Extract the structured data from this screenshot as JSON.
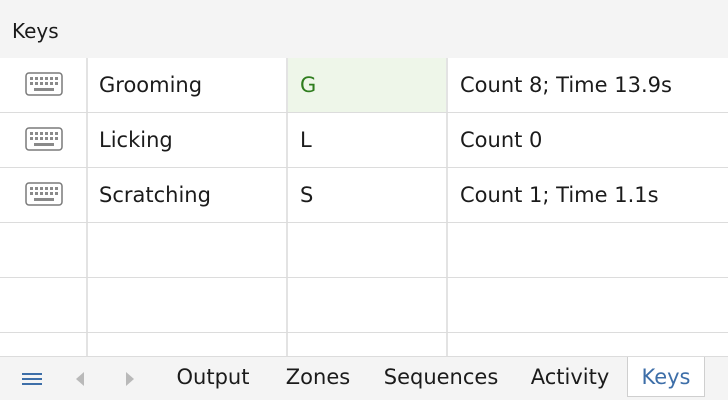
{
  "panel": {
    "title": "Keys"
  },
  "keys": [
    {
      "label": "Grooming",
      "key": "G",
      "summary": "Count 8; Time 13.9s",
      "icon": "keyboard-icon",
      "active": true
    },
    {
      "label": "Licking",
      "key": "L",
      "summary": "Count 0",
      "icon": "keyboard-icon",
      "active": false
    },
    {
      "label": "Scratching",
      "key": "S",
      "summary": "Count 1; Time 1.1s",
      "icon": "keyboard-icon",
      "active": false
    }
  ],
  "tabs": [
    {
      "label": "Output"
    },
    {
      "label": "Zones"
    },
    {
      "label": "Sequences"
    },
    {
      "label": "Activity"
    },
    {
      "label": "Keys",
      "selected": true
    }
  ],
  "icons": {
    "menu": "hamburger-menu-icon",
    "prev": "chevron-left-icon",
    "next": "chevron-right-icon"
  },
  "colors": {
    "accent": "#3d6ea8",
    "active_cell_bg": "#eef6e9",
    "active_cell_text": "#2f7d1e",
    "disabled_arrow": "#b9b9b9"
  }
}
